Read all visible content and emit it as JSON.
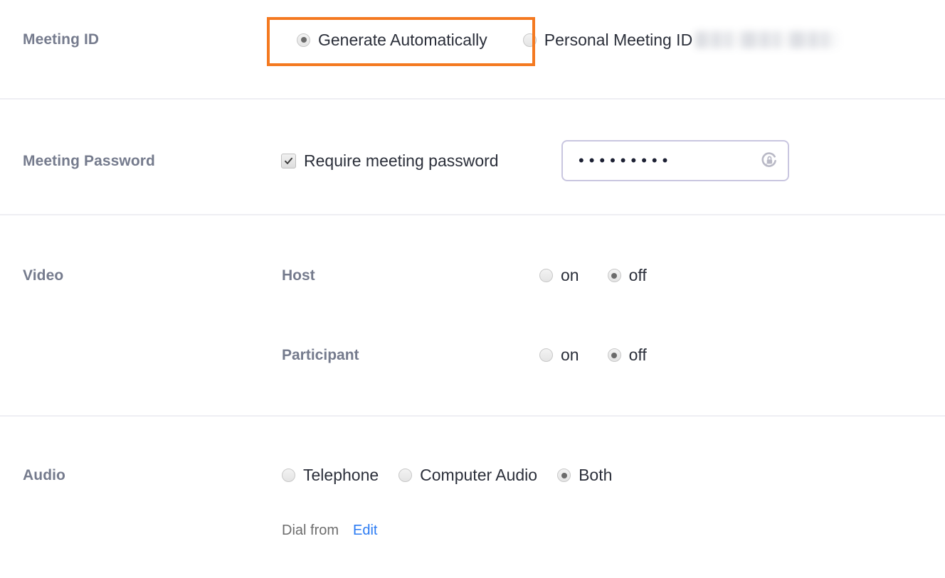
{
  "theme": {
    "highlight_color": "#f47920",
    "label_color": "#757b8d",
    "link_color": "#2b7bf3",
    "divider_color": "#eeeef3",
    "text_color": "#2b2f3a"
  },
  "rows": {
    "meeting_id": {
      "label": "Meeting ID",
      "options": [
        {
          "label": "Generate Automatically",
          "selected": true
        },
        {
          "label": "Personal Meeting ID",
          "selected": false
        }
      ],
      "personal_meeting_id_value": "",
      "personal_meeting_id_redacted": true,
      "highlighted_option": "Generate Automatically"
    },
    "meeting_password": {
      "label": "Meeting Password",
      "checkbox_label": "Require meeting password",
      "checked": true,
      "password_masked": "•••••••••",
      "password_char_count": 9,
      "password_icon": "lock-refresh-icon"
    },
    "video": {
      "label": "Video",
      "groups": [
        {
          "sub_label": "Host",
          "options": [
            {
              "label": "on",
              "selected": false
            },
            {
              "label": "off",
              "selected": true
            }
          ]
        },
        {
          "sub_label": "Participant",
          "options": [
            {
              "label": "on",
              "selected": false
            },
            {
              "label": "off",
              "selected": true
            }
          ]
        }
      ]
    },
    "audio": {
      "label": "Audio",
      "options": [
        {
          "label": "Telephone",
          "selected": false
        },
        {
          "label": "Computer Audio",
          "selected": false
        },
        {
          "label": "Both",
          "selected": true
        }
      ],
      "dial_from_label": "Dial from",
      "dial_from_edit_label": "Edit"
    }
  }
}
